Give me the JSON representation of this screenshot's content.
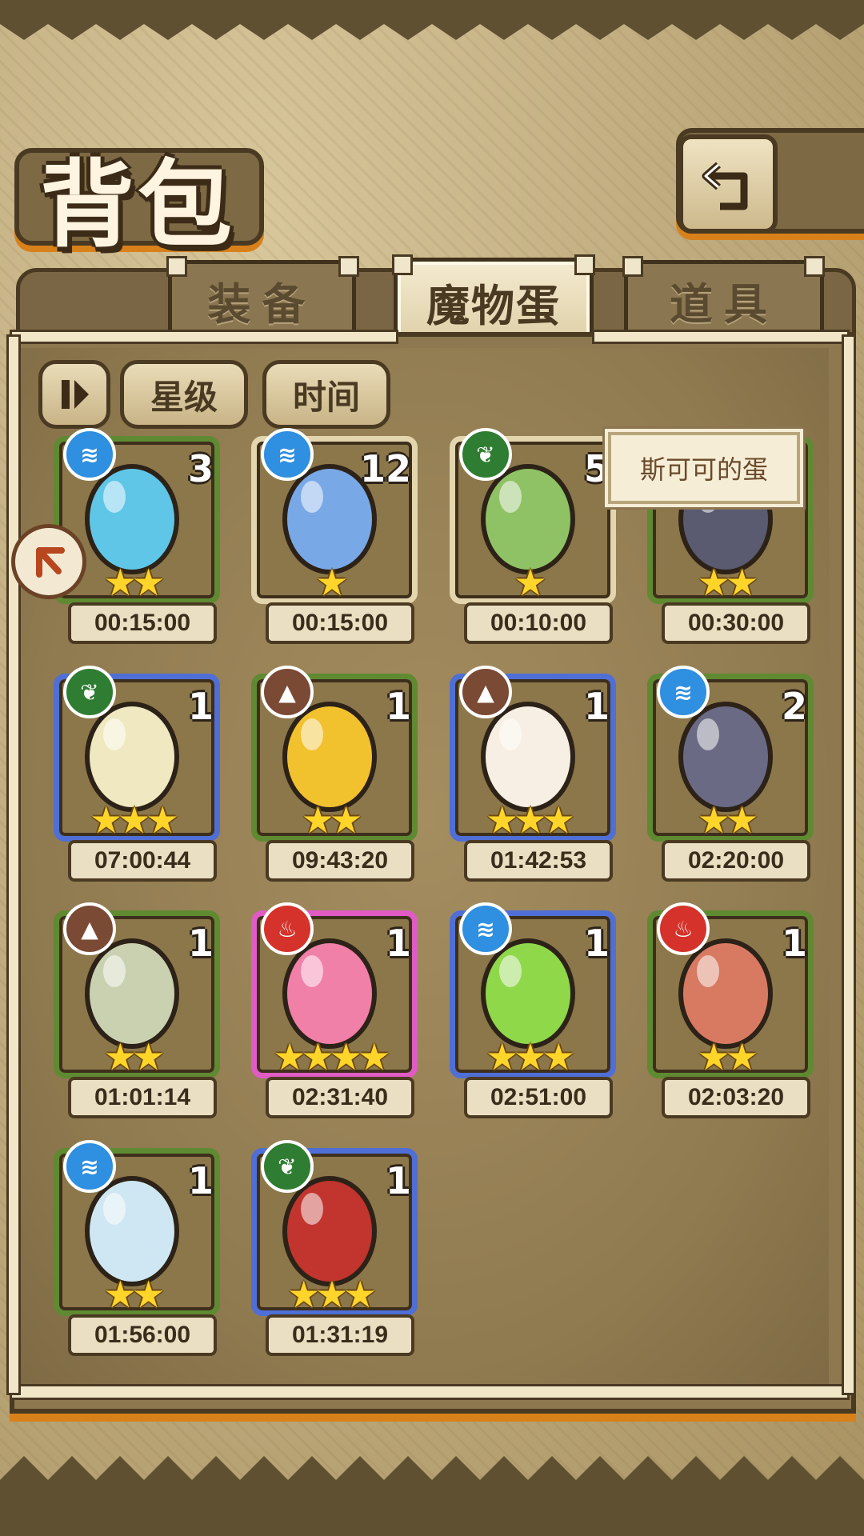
{
  "header": {
    "title": "背包",
    "back_icon": "return-icon"
  },
  "tabs": [
    {
      "label": "装备",
      "active": false
    },
    {
      "label": "魔物蛋",
      "active": true
    },
    {
      "label": "道具",
      "active": false
    }
  ],
  "filters": {
    "toggle_icon": "pause-sort-icon",
    "star_label": "星级",
    "time_label": "时间"
  },
  "tooltip": "斯可可的蛋",
  "colors": {
    "water": "#2f8fe0",
    "grass": "#2f7d32",
    "earth": "#7a4a35",
    "fire": "#d4322a"
  },
  "eggs": [
    {
      "element": "water",
      "count": "3",
      "stars": 2,
      "time": "00:15:00",
      "frame": "green",
      "color": "#5fc6e8"
    },
    {
      "element": "water",
      "count": "12",
      "stars": 1,
      "time": "00:15:00",
      "frame": "cream",
      "color": "#79a8e6"
    },
    {
      "element": "grass",
      "count": "5",
      "stars": 1,
      "time": "00:10:00",
      "frame": "cream",
      "color": "#8fc264"
    },
    {
      "element": "",
      "count": "",
      "stars": 2,
      "time": "00:30:00",
      "frame": "green",
      "color": "#5a5a70"
    },
    {
      "element": "grass",
      "count": "1",
      "stars": 3,
      "time": "07:00:44",
      "frame": "blue",
      "color": "#f0e8c0"
    },
    {
      "element": "earth",
      "count": "1",
      "stars": 2,
      "time": "09:43:20",
      "frame": "green",
      "color": "#f2c12e"
    },
    {
      "element": "earth",
      "count": "1",
      "stars": 3,
      "time": "01:42:53",
      "frame": "blue",
      "color": "#f7efe3"
    },
    {
      "element": "water",
      "count": "2",
      "stars": 2,
      "time": "02:20:00",
      "frame": "green",
      "color": "#6a6a84"
    },
    {
      "element": "earth",
      "count": "1",
      "stars": 2,
      "time": "01:01:14",
      "frame": "green",
      "color": "#c9d1b0"
    },
    {
      "element": "fire",
      "count": "1",
      "stars": 4,
      "time": "02:31:40",
      "frame": "pink",
      "color": "#f080a8"
    },
    {
      "element": "water",
      "count": "1",
      "stars": 3,
      "time": "02:51:00",
      "frame": "blue",
      "color": "#8fd84a"
    },
    {
      "element": "fire",
      "count": "1",
      "stars": 2,
      "time": "02:03:20",
      "frame": "green",
      "color": "#d87a62"
    },
    {
      "element": "water",
      "count": "1",
      "stars": 2,
      "time": "01:56:00",
      "frame": "green",
      "color": "#cfe7f2"
    },
    {
      "element": "grass",
      "count": "1",
      "stars": 3,
      "time": "01:31:19",
      "frame": "blue",
      "color": "#c2342e"
    }
  ]
}
